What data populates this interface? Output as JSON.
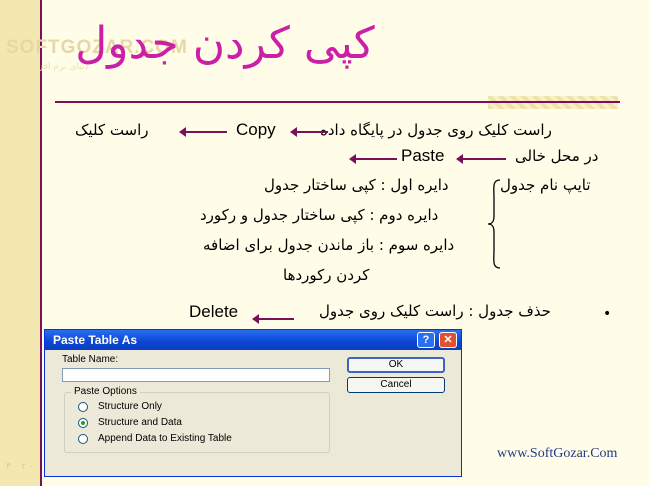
{
  "watermark": {
    "logo": "SOFTGOZAR.COM",
    "subtitle": "دنیای نرم افزار ایران",
    "footer": "۴ ۰ ۲ ۰"
  },
  "slide": {
    "title": "کپی کردن جدول",
    "lines": {
      "line1_rtl": "راست کلیک روی جدول در پایگاه داده",
      "copy": "Copy",
      "line1_end": "راست کلیک",
      "line2_rtl": "در محل خالی",
      "paste": "Paste",
      "type_name": "تایپ نام جدول",
      "option1": "دایره اول : کپی ساختار جدول",
      "option2": "دایره دوم : کپی ساختار جدول و رکورد",
      "option3": "دایره سوم : باز ماندن جدول برای اضافه",
      "option3_cont": "کردن رکوردها",
      "delete_rtl": "حذف جدول : راست کلیک روی جدول",
      "delete": "Delete",
      "bullet": "•"
    },
    "site": "www.SoftGozar.Com"
  },
  "dialog": {
    "title": "Paste Table As",
    "help": "?",
    "close": "✕",
    "table_name_label": "Table Name:",
    "table_name_value": "",
    "paste_options_label": "Paste Options",
    "options": [
      {
        "label": "Structure Only",
        "selected": false
      },
      {
        "label": "Structure and Data",
        "selected": true
      },
      {
        "label": "Append Data to Existing Table",
        "selected": false
      }
    ],
    "ok": "OK",
    "cancel": "Cancel"
  }
}
